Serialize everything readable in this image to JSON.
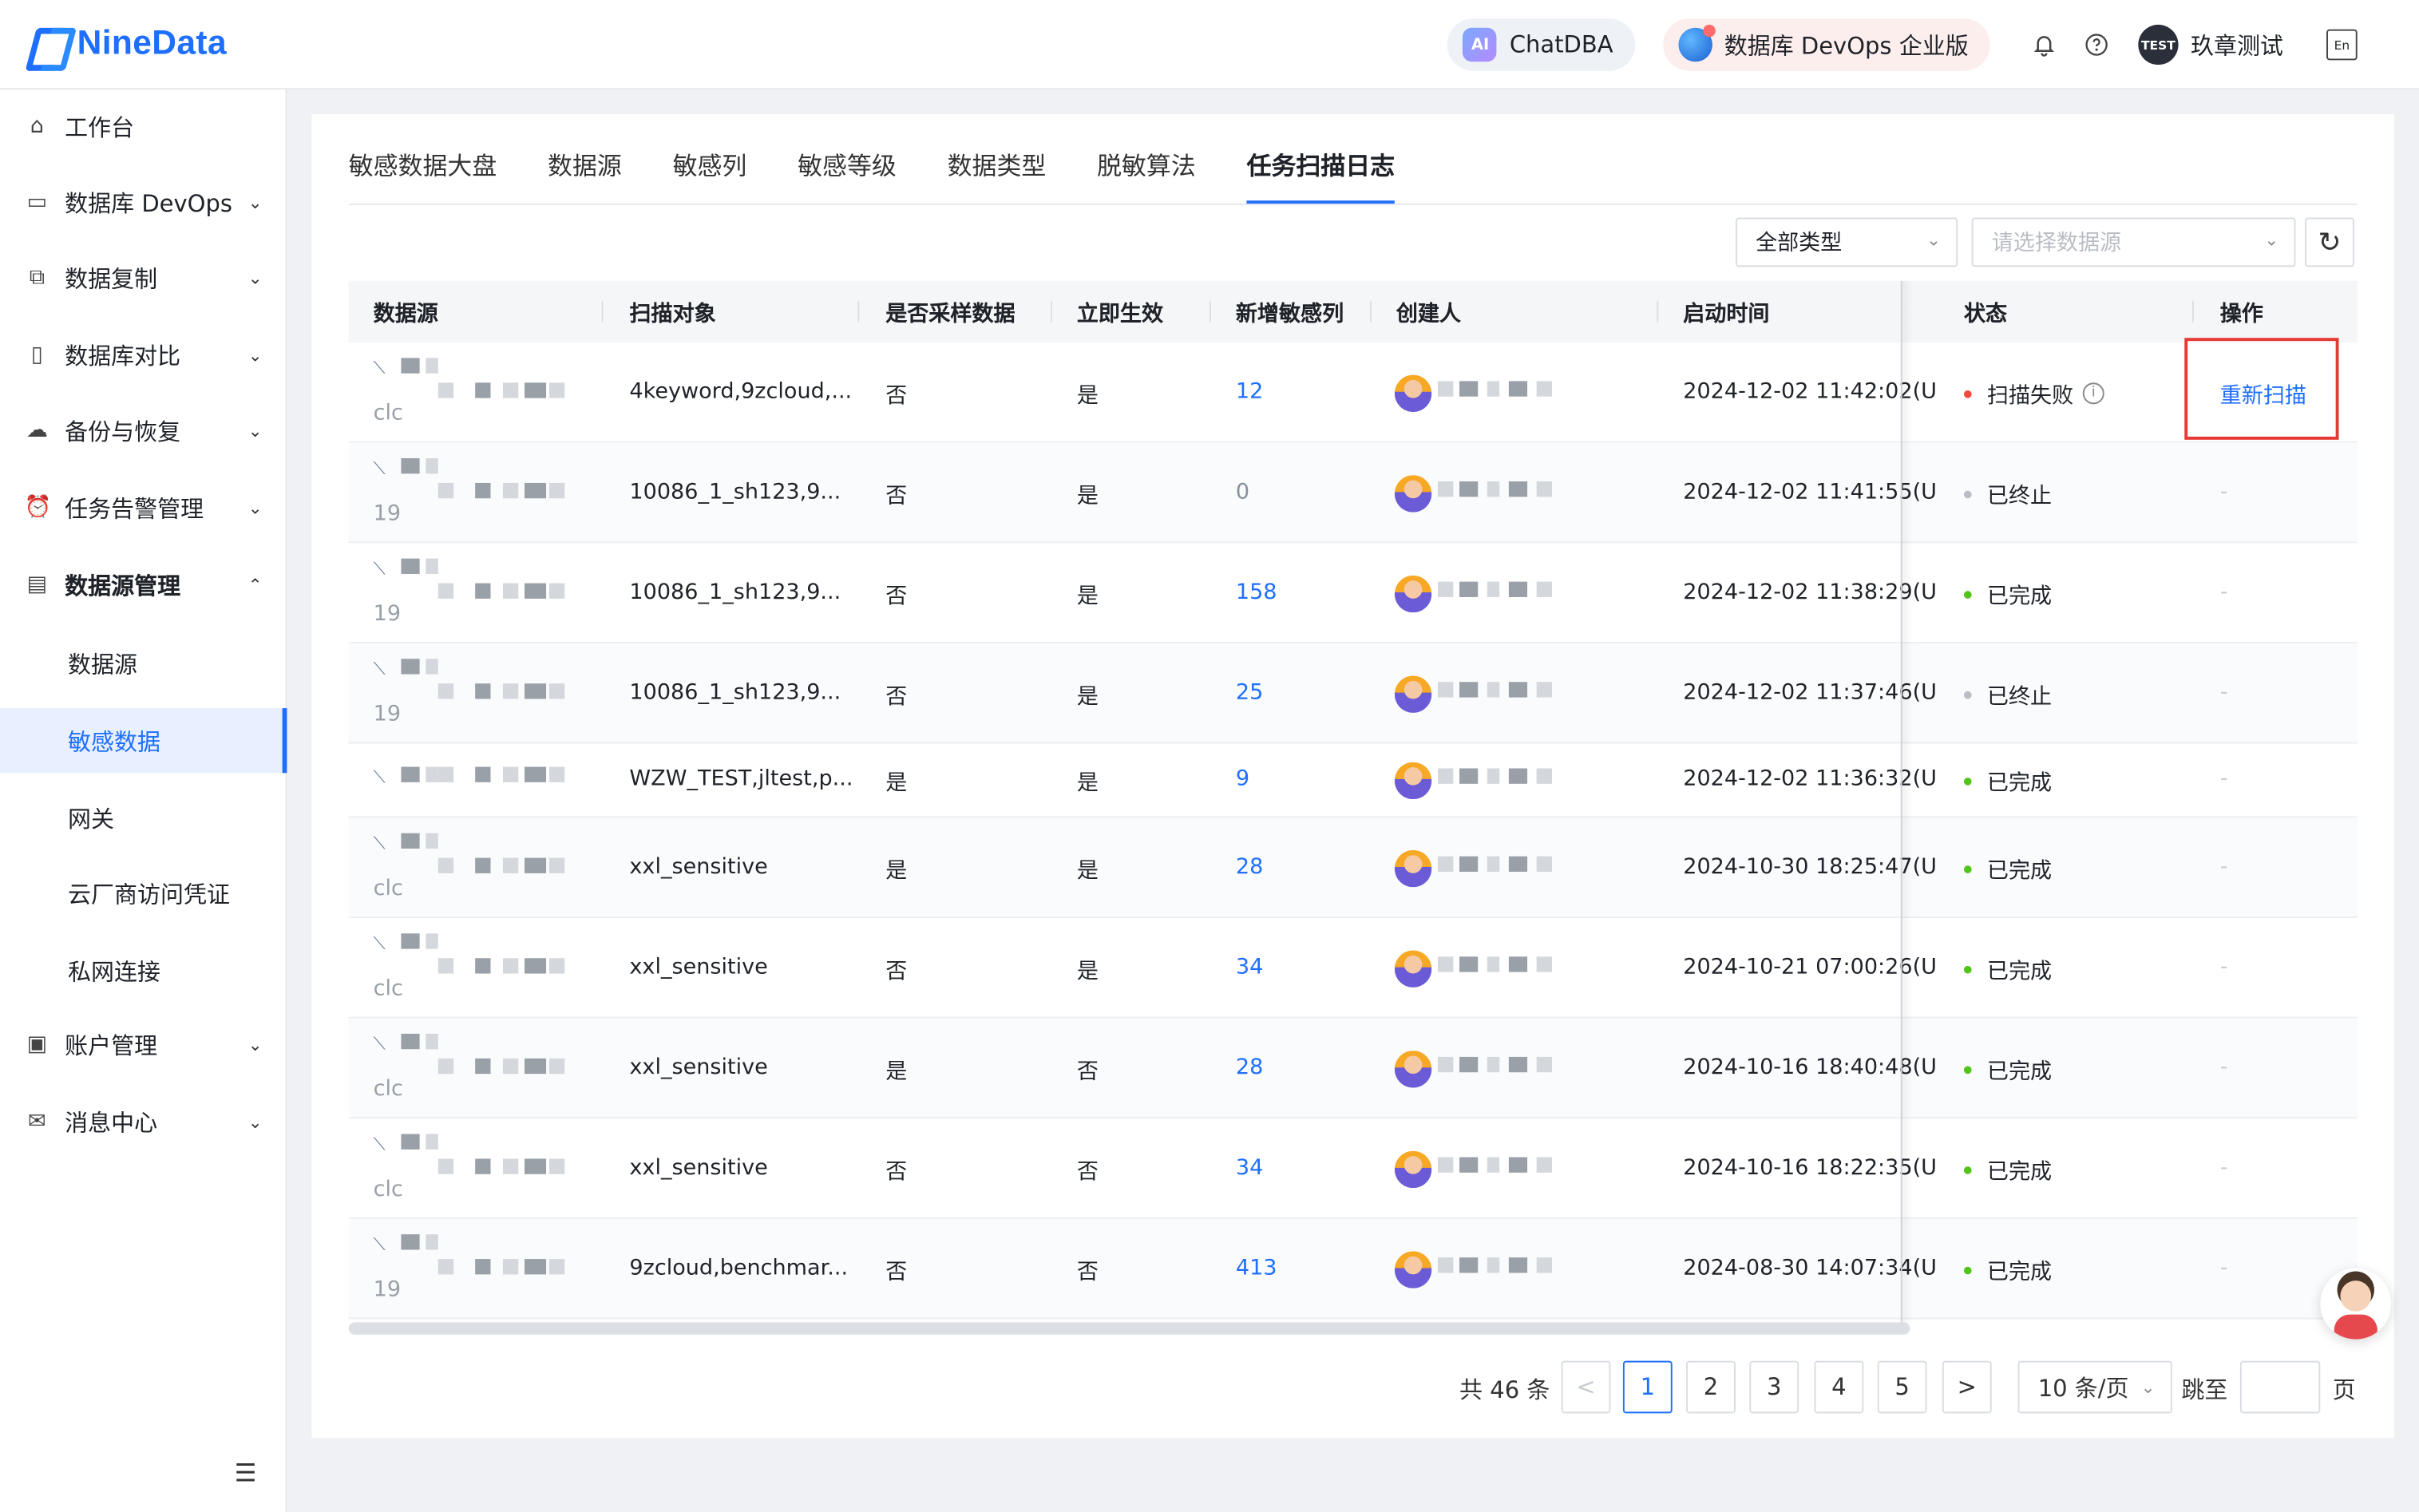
{
  "header": {
    "logo_text": "NineData",
    "chat_label": "ChatDBA",
    "chat_badge": "AI",
    "devops_label": "数据库 DevOps 企业版",
    "user_avatar_text": "TEST",
    "user_name": "玖章测试",
    "icons": [
      "bell-icon",
      "help-icon",
      "language-icon"
    ]
  },
  "sidebar": {
    "items": [
      {
        "label": "工作台",
        "icon": "home-icon"
      },
      {
        "label": "数据库 DevOps",
        "icon": "monitor-icon"
      },
      {
        "label": "数据复制",
        "icon": "copy-icon"
      },
      {
        "label": "数据库对比",
        "icon": "compare-icon"
      },
      {
        "label": "备份与恢复",
        "icon": "cloud-icon"
      },
      {
        "label": "任务告警管理",
        "icon": "alarm-icon"
      },
      {
        "label": "数据源管理",
        "icon": "datasource-icon"
      },
      {
        "label": "账户管理",
        "icon": "account-icon"
      },
      {
        "label": "消息中心",
        "icon": "mail-icon"
      }
    ],
    "sub_items": [
      "数据源",
      "敏感数据",
      "网关",
      "云厂商访问凭证",
      "私网连接"
    ],
    "active_sub": "敏感数据"
  },
  "tabs": [
    "敏感数据大盘",
    "数据源",
    "敏感列",
    "敏感等级",
    "数据类型",
    "脱敏算法",
    "任务扫描日志"
  ],
  "active_tab": "任务扫描日志",
  "filters": {
    "type_value": "全部类型",
    "datasource_placeholder": "请选择数据源"
  },
  "table": {
    "columns": [
      "数据源",
      "扫描对象",
      "是否采样数据",
      "立即生效",
      "新增敏感列",
      "创建人",
      "启动时间",
      "状态",
      "操作"
    ],
    "rows": [
      {
        "ds_prefix": "clc",
        "object": "4keyword,9zcloud,...",
        "sample": "否",
        "effect": "是",
        "new_cols": "12",
        "time": "2024-12-02 11:42:02(U",
        "status": "扫描失败",
        "status_kind": "fail",
        "action": "重新扫描"
      },
      {
        "ds_prefix": "19",
        "object": "10086_1_sh123,9...",
        "sample": "否",
        "effect": "是",
        "new_cols": "0",
        "time": "2024-12-02 11:41:55(U",
        "status": "已终止",
        "status_kind": "stopped",
        "action": "-"
      },
      {
        "ds_prefix": "19",
        "object": "10086_1_sh123,9...",
        "sample": "否",
        "effect": "是",
        "new_cols": "158",
        "time": "2024-12-02 11:38:29(U",
        "status": "已完成",
        "status_kind": "done",
        "action": "-"
      },
      {
        "ds_prefix": "19",
        "object": "10086_1_sh123,9...",
        "sample": "否",
        "effect": "是",
        "new_cols": "25",
        "time": "2024-12-02 11:37:46(U",
        "status": "已终止",
        "status_kind": "stopped",
        "action": "-"
      },
      {
        "ds_prefix": "",
        "object": "WZW_TEST,jltest,p...",
        "sample": "是",
        "effect": "是",
        "new_cols": "9",
        "time": "2024-12-02 11:36:32(U",
        "status": "已完成",
        "status_kind": "done",
        "action": "-"
      },
      {
        "ds_prefix": "clc",
        "object": "xxl_sensitive",
        "sample": "是",
        "effect": "是",
        "new_cols": "28",
        "time": "2024-10-30 18:25:47(U",
        "status": "已完成",
        "status_kind": "done",
        "action": "-"
      },
      {
        "ds_prefix": "clc",
        "object": "xxl_sensitive",
        "sample": "否",
        "effect": "是",
        "new_cols": "34",
        "time": "2024-10-21 07:00:26(U",
        "status": "已完成",
        "status_kind": "done",
        "action": "-"
      },
      {
        "ds_prefix": "clc",
        "object": "xxl_sensitive",
        "sample": "是",
        "effect": "否",
        "new_cols": "28",
        "time": "2024-10-16 18:40:48(U",
        "status": "已完成",
        "status_kind": "done",
        "action": "-"
      },
      {
        "ds_prefix": "clc",
        "object": "xxl_sensitive",
        "sample": "否",
        "effect": "否",
        "new_cols": "34",
        "time": "2024-10-16 18:22:35(U",
        "status": "已完成",
        "status_kind": "done",
        "action": "-"
      },
      {
        "ds_prefix": "19",
        "object": "9zcloud,benchmar...",
        "sample": "否",
        "effect": "否",
        "new_cols": "413",
        "time": "2024-08-30 14:07:34(U",
        "status": "已完成",
        "status_kind": "done",
        "action": "-"
      }
    ]
  },
  "pagination": {
    "total_text": "共 46 条",
    "pages": [
      "1",
      "2",
      "3",
      "4",
      "5"
    ],
    "current": "1",
    "prev": "<",
    "next": ">",
    "page_size": "10 条/页",
    "jump_label": "跳至",
    "page_label": "页"
  }
}
